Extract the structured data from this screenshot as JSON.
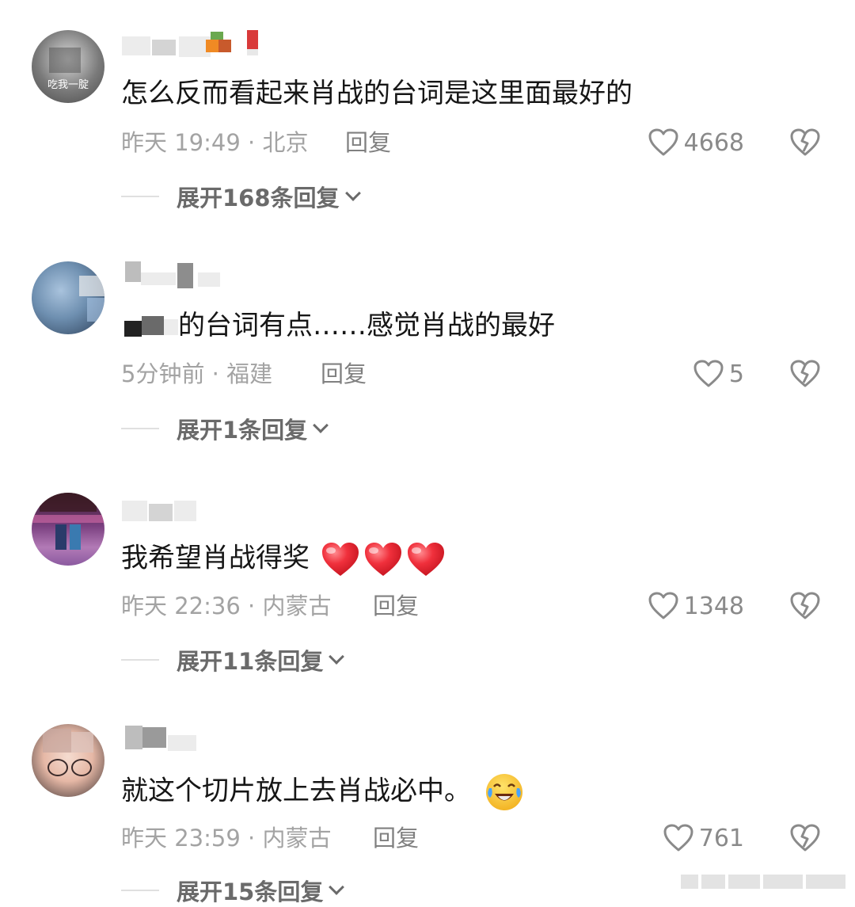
{
  "comments": [
    {
      "avatar_caption": "吃我一腚",
      "text": "怎么反而看起来肖战的台词是这里面最好的",
      "meta": "昨天 19:49 · 北京",
      "reply_label": "回复",
      "likes": "4668",
      "expand_label": "展开168条回复"
    },
    {
      "text": "的台词有点……感觉肖战的最好",
      "meta": "5分钟前 · 福建",
      "reply_label": "回复",
      "likes": "5",
      "expand_label": "展开1条回复"
    },
    {
      "text": "我希望肖战得奖",
      "meta": "昨天 22:36 · 内蒙古",
      "reply_label": "回复",
      "likes": "1348",
      "expand_label": "展开11条回复"
    },
    {
      "text": "就这个切片放上去肖战必中。",
      "meta": "昨天 23:59 · 内蒙古",
      "reply_label": "回复",
      "likes": "761",
      "expand_label": "展开15条回复"
    }
  ],
  "icons": {
    "like": "heart-outline-icon",
    "dislike": "broken-heart-icon",
    "expand": "chevron-down-icon",
    "emoji_heart": "red-heart-emoji",
    "emoji_cry": "laughing-crying-emoji"
  },
  "colors": {
    "text_primary": "#161616",
    "text_meta": "#a3a3a3",
    "text_reply": "#808080",
    "like_count": "#8a8a8a",
    "expand_text": "#6a6a6a",
    "heart_emoji": "#f0303c"
  }
}
